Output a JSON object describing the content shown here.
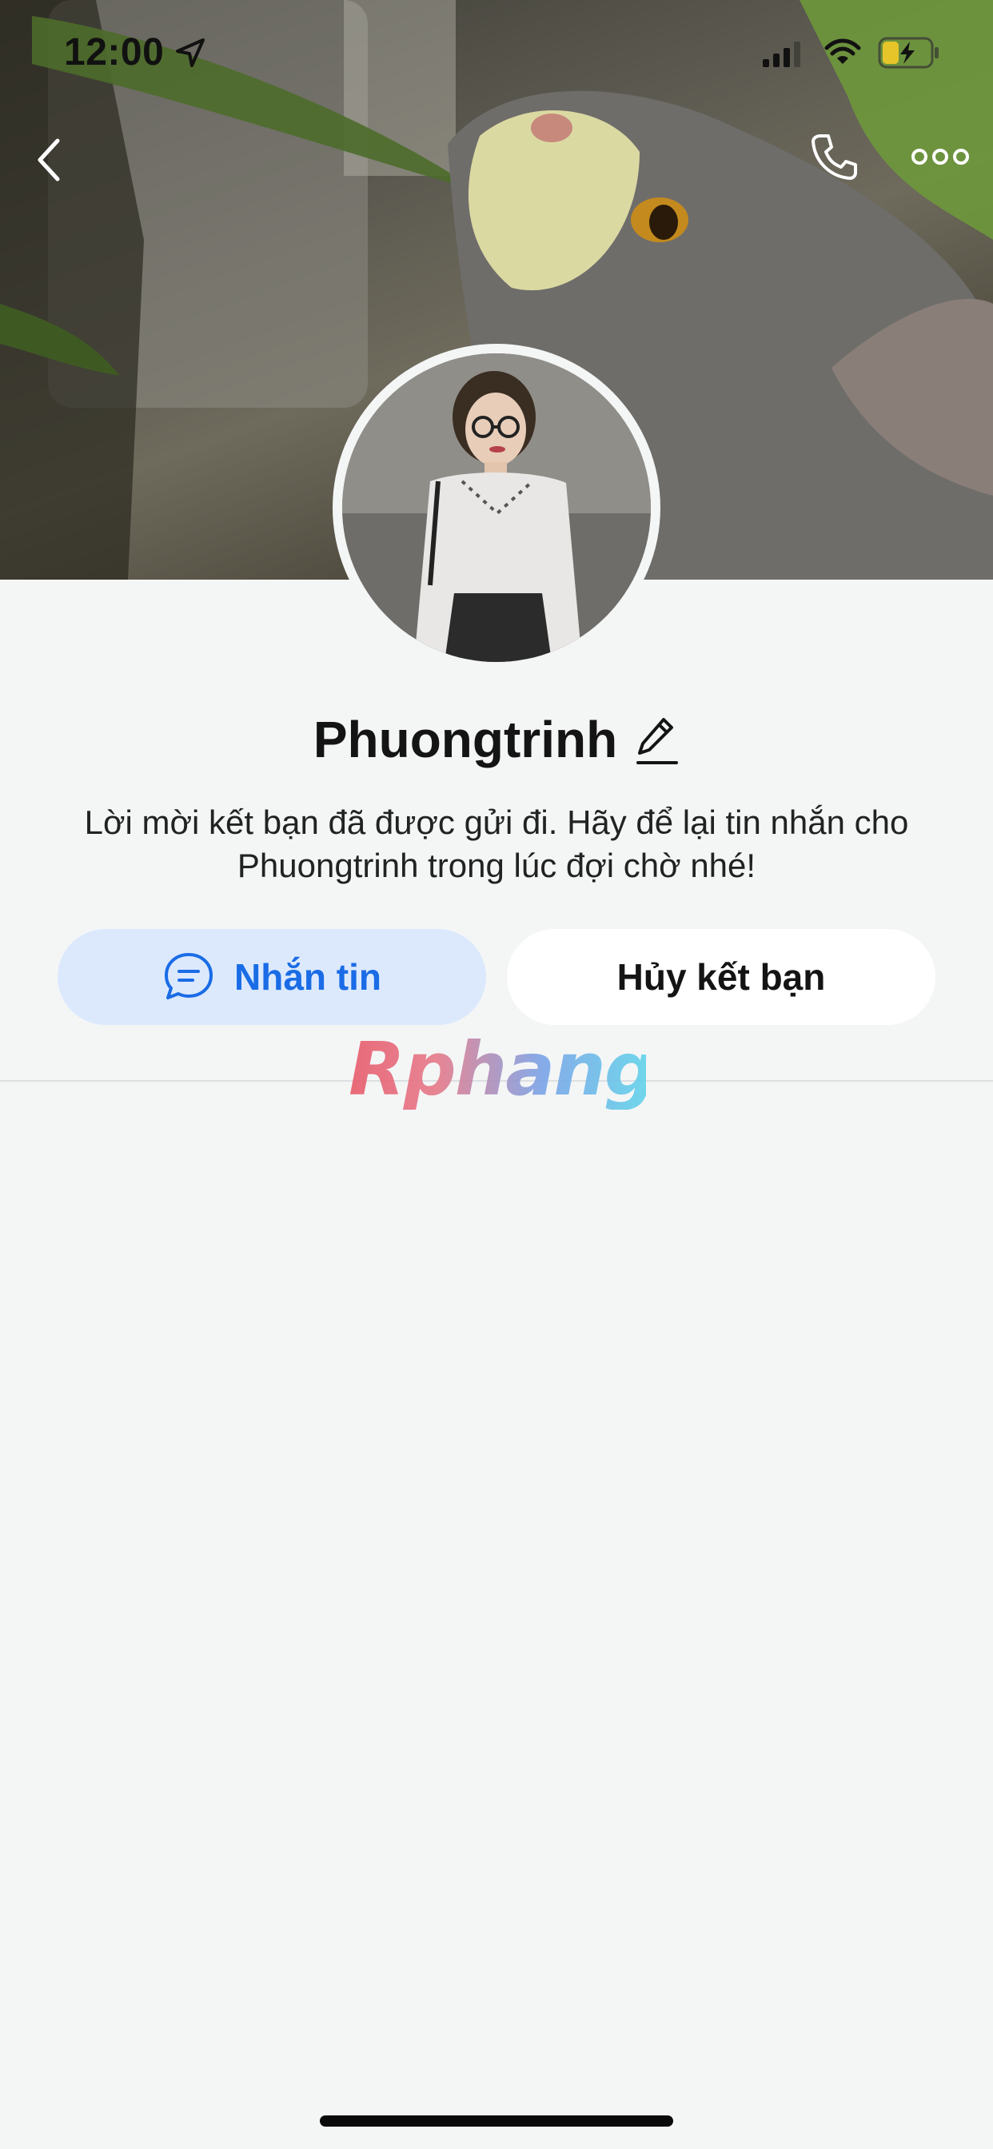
{
  "status_bar": {
    "time": "12:00",
    "icons": [
      "location-arrow-icon",
      "cellular-signal-icon",
      "wifi-icon",
      "battery-charging-icon"
    ]
  },
  "nav": {
    "back_icon": "chevron-left-icon",
    "call_icon": "phone-icon",
    "more_icon": "more-dots-icon"
  },
  "profile": {
    "name": "Phuongtrinh",
    "edit_icon": "pencil-icon",
    "message": "Lời mời kết bạn đã được gửi đi. Hãy để lại tin nhắn cho Phuongtrinh trong lúc đợi chờ nhé!"
  },
  "actions": {
    "message_label": "Nhắn tin",
    "message_icon": "chat-bubble-icon",
    "unfriend_label": "Hủy kết bạn"
  },
  "watermark": {
    "text": "Rphang"
  },
  "colors": {
    "accent": "#1a6ce6",
    "accent_bg": "#dce9fd",
    "background": "#f4f6f6"
  }
}
